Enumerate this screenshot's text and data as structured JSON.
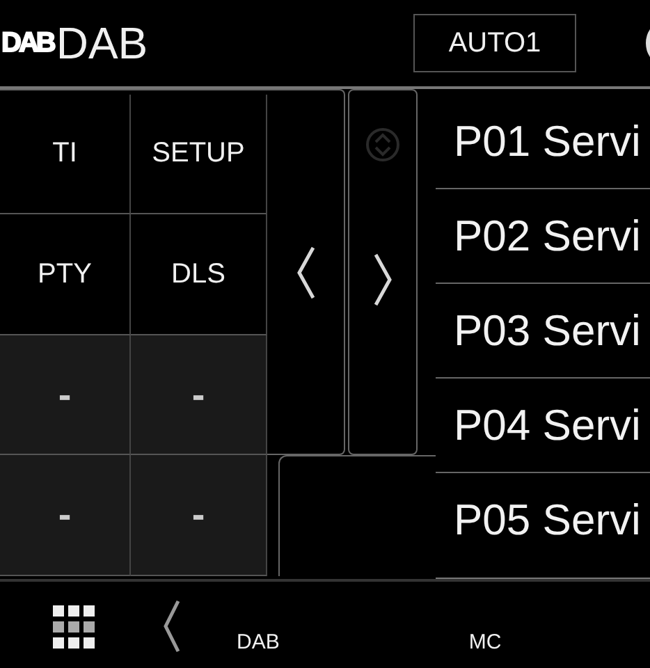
{
  "header": {
    "logo": "DAB",
    "title": "DAB",
    "mode_button": "AUTO1"
  },
  "function_buttons": [
    {
      "label": "TI",
      "kind": "text"
    },
    {
      "label": "SETUP",
      "kind": "text"
    },
    {
      "label": "PTY",
      "kind": "text"
    },
    {
      "label": "DLS",
      "kind": "text"
    },
    {
      "label": "-",
      "kind": "empty"
    },
    {
      "label": "-",
      "kind": "empty"
    },
    {
      "label": "-",
      "kind": "empty"
    },
    {
      "label": "-",
      "kind": "empty"
    }
  ],
  "presets": [
    {
      "label": "P01 Servi"
    },
    {
      "label": "P02 Servi"
    },
    {
      "label": "P03 Servi"
    },
    {
      "label": "P04 Servi"
    },
    {
      "label": "P05 Servi"
    }
  ],
  "bottom_bar": {
    "sources": [
      "DAB",
      "MC"
    ]
  }
}
